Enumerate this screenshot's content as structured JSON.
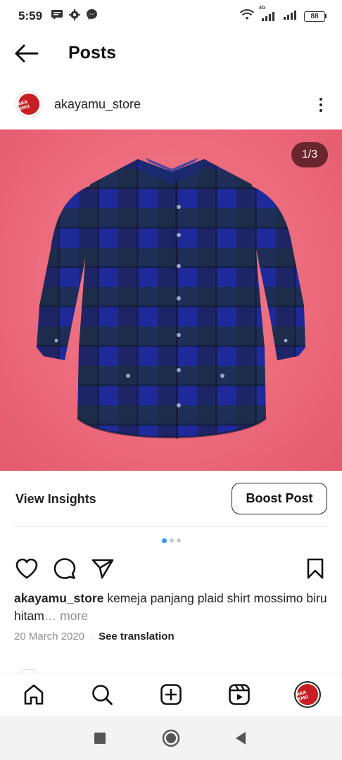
{
  "status_bar": {
    "time": "5:59",
    "network_label": "4G",
    "battery_level": "88",
    "icons": [
      "message-icon",
      "settings-icon",
      "messenger-icon",
      "wifi-icon",
      "signal-icon",
      "battery-icon"
    ]
  },
  "header": {
    "title": "Posts",
    "back_icon": "arrow-left-icon"
  },
  "post": {
    "username": "akayamu_store",
    "avatar_text": "AKA SMU",
    "image_counter": "1/3",
    "image_description_color": "#ec6b7c",
    "carousel": {
      "current": 1,
      "total": 3
    },
    "view_insights_label": "View Insights",
    "boost_post_label": "Boost Post",
    "caption_user": "akayamu_store",
    "caption_text": " kemeja panjang plaid shirt mossimo biru hitam",
    "caption_more": "… more",
    "date": "20 March 2020",
    "meta_separator": "·",
    "see_translation_label": "See translation"
  },
  "bottom_nav": {
    "items": [
      "home-icon",
      "search-icon",
      "create-icon",
      "reels-icon",
      "profile-avatar"
    ]
  },
  "system_nav": {
    "items": [
      "recents-square-icon",
      "home-circle-icon",
      "back-triangle-icon"
    ]
  },
  "colors": {
    "accent_dot": "#3897f0",
    "photo_background": "#ec6b7c",
    "shirt_blue": "#1f2a8f",
    "shirt_dark": "#1a2233",
    "avatar_red": "#c81e23"
  }
}
